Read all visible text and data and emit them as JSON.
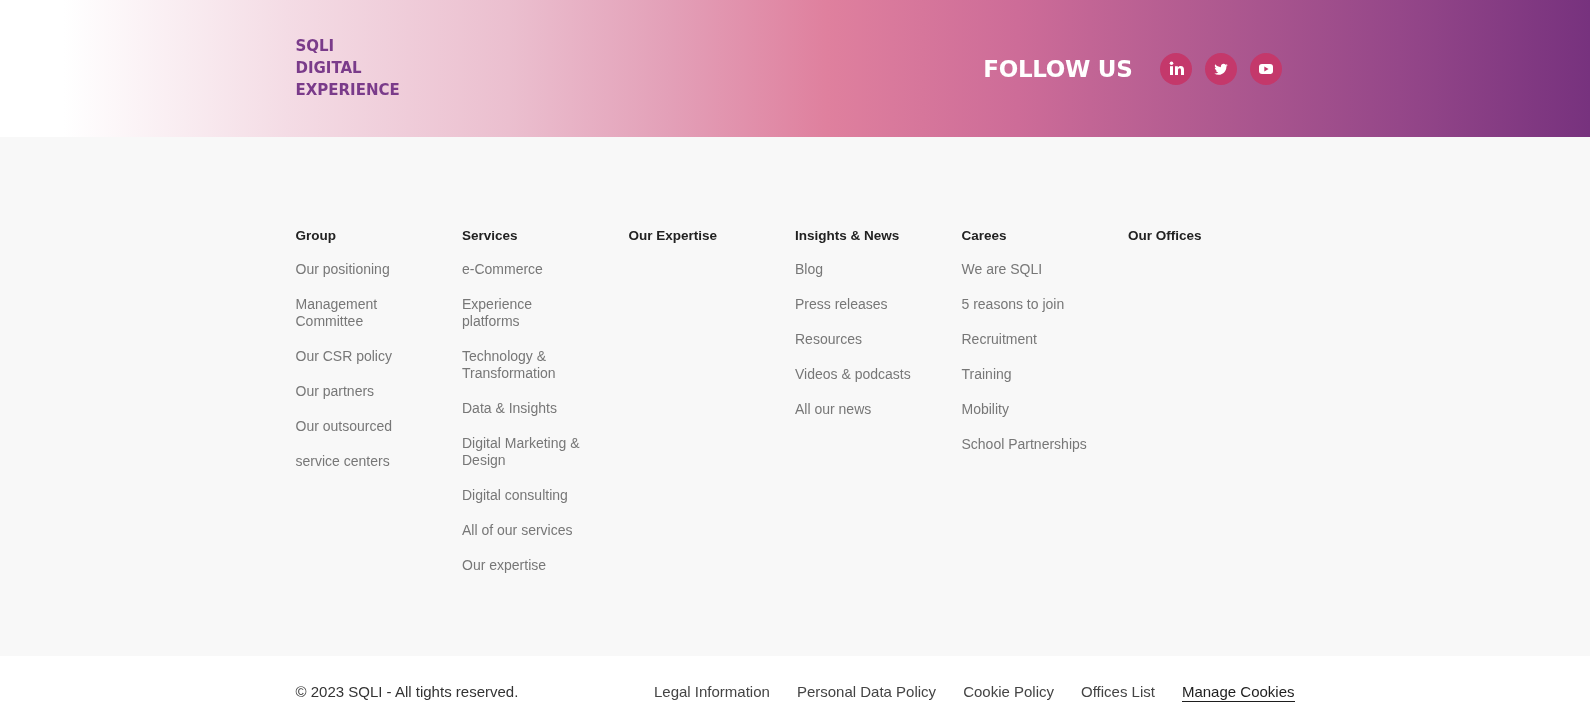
{
  "banner": {
    "logo": "SQLI DIGITAL EXPERIENCE",
    "follow_label": "FOLLOW US",
    "social_links": [
      {
        "kind": "linkedin"
      },
      {
        "kind": "twitter"
      },
      {
        "kind": "youtube"
      }
    ]
  },
  "footer_columns": [
    {
      "heading": "Group",
      "links": [
        "Our positioning",
        "Management Committee",
        "Our CSR policy",
        "Our partners",
        "Our outsourced",
        "service centers"
      ]
    },
    {
      "heading": "Services",
      "links": [
        "e-Commerce",
        "Experience platforms",
        "Technology & Transformation",
        "Data & Insights",
        "Digital Marketing & Design",
        "Digital consulting",
        "All of our services",
        "Our expertise"
      ]
    },
    {
      "heading": "Our Expertise"
    },
    {
      "heading": "Insights & News",
      "links": [
        "Blog",
        "Press releases",
        "Resources",
        "Videos & podcasts",
        "All our news"
      ]
    },
    {
      "heading": "Carees",
      "links": [
        "We are SQLI",
        "5 reasons to join",
        "Recruitment",
        "Training",
        "Mobility",
        "School Partnerships"
      ]
    },
    {
      "heading": "Our Offices"
    }
  ],
  "bottom_bar": {
    "copyright": "© 2023 SQLI - All tights reserved.",
    "links": [
      {
        "label": "Legal Information",
        "kind": "link"
      },
      {
        "label": "Personal Data Policy",
        "kind": "link"
      },
      {
        "label": "Cookie Policy",
        "kind": "link"
      },
      {
        "label": "Offices List",
        "kind": "link"
      },
      {
        "label": "Manage Cookies",
        "kind": "button"
      }
    ]
  }
}
